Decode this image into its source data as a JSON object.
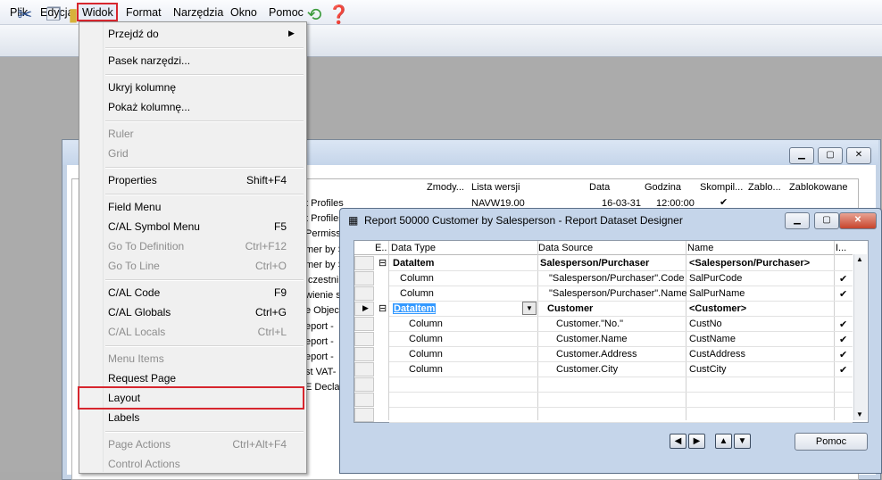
{
  "menubar": {
    "items": [
      "Plik",
      "Edycja",
      "Widok",
      "Format",
      "Narzędzia",
      "Okno",
      "Pomoc"
    ]
  },
  "toolbar": {
    "icons": [
      "cut-icon",
      "copy-icon",
      "paste-icon",
      "refresh-icon",
      "help-icon"
    ]
  },
  "background_window": {
    "headers": [
      "Zmody...",
      "Lista wersji",
      "Data",
      "Godzina",
      "Skompil...",
      "Zablo...",
      "Zablokowane"
    ],
    "row1": {
      "name": "t Profiles",
      "version": "NAVW19.00",
      "date": "16-03-31",
      "time": "12:00:00"
    },
    "left_fragments": [
      "t Profiles",
      "t Profiles",
      "Permiss",
      "mer by S",
      "mer by S",
      "ıczestnik",
      "wienie s",
      "e Objec",
      "eport -",
      "eport -",
      "eport -",
      "st VAT-",
      "E Declar"
    ]
  },
  "view_menu": {
    "items": [
      {
        "label": "Przejdź do",
        "shortcut": "",
        "disabled": false,
        "submenu": true
      },
      {
        "label": "Pasek narzędzi...",
        "shortcut": "",
        "disabled": false
      },
      {
        "label": "Ukryj kolumnę",
        "shortcut": "",
        "disabled": false
      },
      {
        "label": "Pokaż kolumnę...",
        "shortcut": "",
        "disabled": false
      },
      {
        "label": "Ruler",
        "shortcut": "",
        "disabled": true
      },
      {
        "label": "Grid",
        "shortcut": "",
        "disabled": true
      },
      {
        "label": "Properties",
        "shortcut": "Shift+F4",
        "disabled": false
      },
      {
        "label": "Field Menu",
        "shortcut": "",
        "disabled": false
      },
      {
        "label": "C/AL Symbol Menu",
        "shortcut": "F5",
        "disabled": false
      },
      {
        "label": "Go To Definition",
        "shortcut": "Ctrl+F12",
        "disabled": true
      },
      {
        "label": "Go To Line",
        "shortcut": "Ctrl+O",
        "disabled": true
      },
      {
        "label": "C/AL Code",
        "shortcut": "F9",
        "disabled": false
      },
      {
        "label": "C/AL Globals",
        "shortcut": "Ctrl+G",
        "disabled": false
      },
      {
        "label": "C/AL Locals",
        "shortcut": "Ctrl+L",
        "disabled": true
      },
      {
        "label": "Menu Items",
        "shortcut": "",
        "disabled": true
      },
      {
        "label": "Request Page",
        "shortcut": "",
        "disabled": false
      },
      {
        "label": "Layout",
        "shortcut": "",
        "disabled": false,
        "highlighted": true
      },
      {
        "label": "Labels",
        "shortcut": "",
        "disabled": false
      },
      {
        "label": "Page Actions",
        "shortcut": "Ctrl+Alt+F4",
        "disabled": true
      },
      {
        "label": "Control Actions",
        "shortcut": "",
        "disabled": true
      }
    ]
  },
  "designer": {
    "title": "Report 50000 Customer by Salesperson - Report Dataset Designer",
    "headers": {
      "e": "E..",
      "data_type": "Data Type",
      "data_source": "Data Source",
      "name": "Name",
      "i": "I..."
    },
    "rows": [
      {
        "data_type": "DataItem",
        "data_source": "Salesperson/Purchaser",
        "name": "<Salesperson/Purchaser>",
        "bold": true,
        "check": ""
      },
      {
        "data_type": "Column",
        "data_source": "\"Salesperson/Purchaser\".Code",
        "name": "SalPurCode",
        "bold": false,
        "check": "✔"
      },
      {
        "data_type": "Column",
        "data_source": "\"Salesperson/Purchaser\".Name",
        "name": "SalPurName",
        "bold": false,
        "check": "✔"
      },
      {
        "data_type": "DataItem",
        "data_source": "Customer",
        "name": "<Customer>",
        "bold": true,
        "check": ""
      },
      {
        "data_type": "Column",
        "data_source": "Customer.\"No.\"",
        "name": "CustNo",
        "bold": false,
        "check": "✔"
      },
      {
        "data_type": "Column",
        "data_source": "Customer.Name",
        "name": "CustName",
        "bold": false,
        "check": "✔"
      },
      {
        "data_type": "Column",
        "data_source": "Customer.Address",
        "name": "CustAddress",
        "bold": false,
        "check": "✔"
      },
      {
        "data_type": "Column",
        "data_source": "Customer.City",
        "name": "CustCity",
        "bold": false,
        "check": "✔"
      }
    ],
    "help_button": "Pomoc"
  },
  "colors": {
    "highlight_border": "#d7262e",
    "selection": "#3399ff"
  }
}
